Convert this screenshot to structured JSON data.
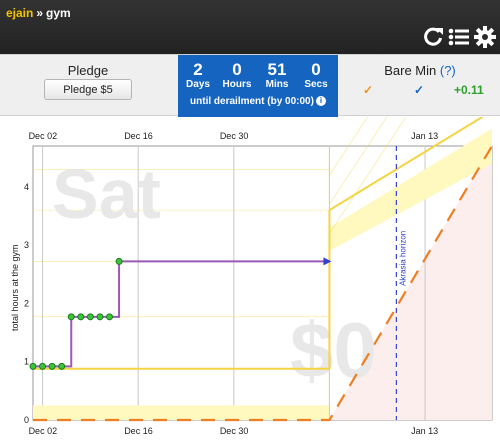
{
  "breadcrumb": {
    "user": "ejain",
    "separator": "»",
    "goal": "gym"
  },
  "toolbar": {
    "icons": [
      "refresh-icon",
      "list-icon",
      "gear-icon"
    ]
  },
  "pledge": {
    "title": "Pledge",
    "button_label": "Pledge $5"
  },
  "countdown": {
    "days": "2",
    "days_label": "Days",
    "hours": "0",
    "hours_label": "Hours",
    "mins": "51",
    "mins_label": "Mins",
    "secs": "0",
    "secs_label": "Secs",
    "caption": "until derailment (by 00:00)",
    "background": "#1565c0"
  },
  "bare_min": {
    "title": "Bare Min",
    "help": "(?)",
    "values": [
      {
        "text": "✓",
        "color": "#f0901e"
      },
      {
        "text": "✓",
        "color": "#1565c0"
      },
      {
        "text": "+0.11",
        "color": "#2e9e2e"
      }
    ]
  },
  "chart_data": {
    "type": "line",
    "ylabel": "total hours at the gym",
    "x_ticks_top": [
      "Dec 02",
      "Dec 16",
      "Dec 30",
      "Jan 13"
    ],
    "x_ticks_bottom": [
      "Dec 02",
      "Dec 16",
      "Dec 30",
      "Jan 13"
    ],
    "y_ticks": [
      "0",
      "1",
      "2",
      "3",
      "4"
    ],
    "ylim": [
      0,
      4.7
    ],
    "xlim": [
      0,
      48
    ],
    "watermark_day": "Sat",
    "watermark_amount": "$0",
    "horizon_label": "Akrasia horizon",
    "horizon_x": 38,
    "today_x": 31,
    "datapoints": [
      {
        "x": 0,
        "y": 0.92
      },
      {
        "x": 1,
        "y": 0.92
      },
      {
        "x": 2,
        "y": 0.92
      },
      {
        "x": 3,
        "y": 0.92
      },
      {
        "x": 4,
        "y": 1.77
      },
      {
        "x": 5,
        "y": 1.77
      },
      {
        "x": 6,
        "y": 1.77
      },
      {
        "x": 7,
        "y": 1.77
      },
      {
        "x": 8,
        "y": 1.77
      },
      {
        "x": 9,
        "y": 2.72
      }
    ],
    "progress_line": [
      [
        0,
        0.92
      ],
      [
        4,
        0.92
      ],
      [
        4,
        1.77
      ],
      [
        9,
        1.77
      ],
      [
        9,
        2.72
      ],
      [
        31,
        2.72
      ]
    ],
    "yellow_road_past": [
      [
        0,
        0.88
      ],
      [
        31,
        0.88
      ]
    ],
    "yellow_road_future": [
      [
        31,
        3.6
      ],
      [
        48,
        5.3
      ]
    ],
    "orange_road": [
      [
        0,
        0
      ],
      [
        31,
        0
      ],
      [
        31,
        0
      ],
      [
        48,
        4.7
      ]
    ],
    "colors": {
      "progress": "#9b59b6",
      "point_fill": "#39c439",
      "point_stroke": "#1a7a1a",
      "road": "#f5d442",
      "road_band": "#fff9c0",
      "bright_red": "#ef7d21",
      "horizon": "#3344cc",
      "future_shade": "#fdeeee"
    }
  }
}
